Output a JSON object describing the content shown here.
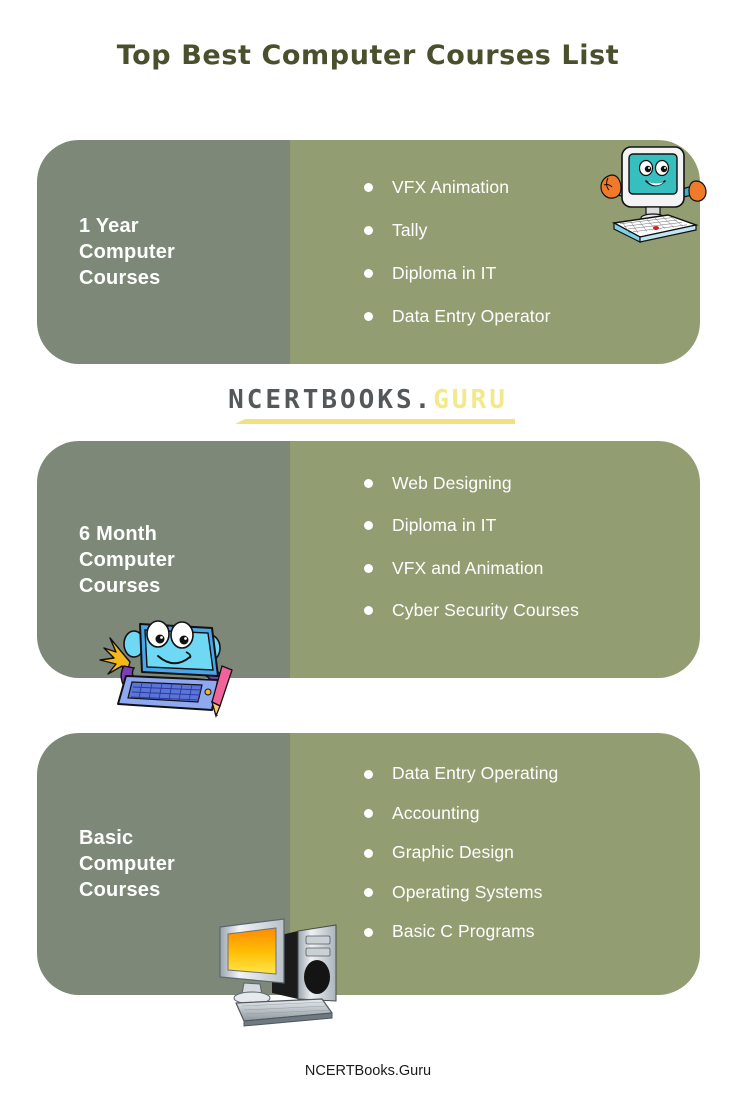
{
  "page": {
    "title": "Top Best Computer Courses List",
    "footer": "NCERTBooks.Guru",
    "background_color": "#ffffff",
    "title_color": "#4a4f2c"
  },
  "watermark": {
    "text_primary": "NCERTBOOKS.",
    "text_accent": "GURU",
    "primary_color": "#55585a",
    "accent_color": "#f2e98a",
    "bar_color": "#f0e27f"
  },
  "theme": {
    "panel_left_color": "#7d8878",
    "panel_right_color": "#939d72",
    "text_color": "#ffffff",
    "bullet_color": "#ffffff"
  },
  "cards": [
    {
      "heading": "1 Year\nComputer\nCourses",
      "heading_line_1": "1 Year",
      "heading_line_2": "Computer",
      "heading_line_3": "Courses",
      "items": [
        "VFX Animation",
        "Tally",
        "Diploma in IT",
        "Data Entry Operator"
      ],
      "illustration": "monitor-character-icon"
    },
    {
      "heading": "6 Month\nComputer\nCourses",
      "heading_line_1": "6 Month",
      "heading_line_2": "Computer",
      "heading_line_3": "Courses",
      "items": [
        "Web Designing",
        "Diploma in IT",
        "VFX and Animation",
        "Cyber Security Courses"
      ],
      "illustration": "laptop-character-icon"
    },
    {
      "heading": "Basic\nComputer\nCourses",
      "heading_line_1": "Basic",
      "heading_line_2": "Computer",
      "heading_line_3": "Courses",
      "items": [
        "Data Entry Operating",
        "Accounting",
        "Graphic Design",
        "Operating Systems",
        "Basic C Programs"
      ],
      "illustration": "desktop-pc-icon"
    }
  ]
}
